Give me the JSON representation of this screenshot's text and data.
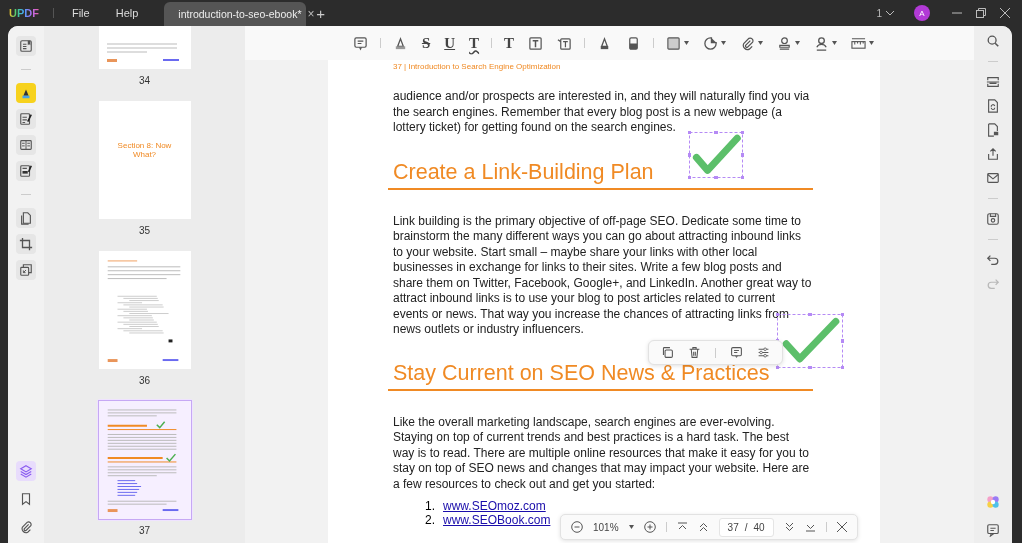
{
  "title_bar": {
    "logo": "UPDF",
    "menus": [
      "File",
      "Help"
    ],
    "tab": {
      "title": "introduction-to-seo-ebook*",
      "close": "×"
    },
    "new_tab": "+",
    "page_count": "1",
    "avatar": "A"
  },
  "left_tool_groups": [
    [
      {
        "kind": "reader",
        "selected": false
      }
    ],
    [
      {
        "kind": "comment",
        "selected": true
      },
      {
        "kind": "edit",
        "selected": false
      },
      {
        "kind": "organize",
        "selected": false
      },
      {
        "kind": "form",
        "selected": false
      }
    ],
    [
      {
        "kind": "pages",
        "selected": false
      },
      {
        "kind": "crop",
        "selected": false
      },
      {
        "kind": "compress",
        "selected": false
      }
    ]
  ],
  "left_bottom": [
    {
      "kind": "layers",
      "selected": true
    },
    {
      "kind": "bookmark",
      "selected": false
    },
    {
      "kind": "attachment",
      "selected": false
    }
  ],
  "thumbnails": [
    {
      "kind": "text",
      "page": "34",
      "selected": false
    },
    {
      "kind": "section",
      "page": "35",
      "selected": false,
      "title": "Section 8: Now What?"
    },
    {
      "kind": "diagram",
      "page": "36",
      "selected": false
    },
    {
      "kind": "article",
      "page": "37",
      "selected": true
    }
  ],
  "toolbar_groups": [
    [
      {
        "kind": "note",
        "dropdown": false
      }
    ],
    [
      {
        "kind": "highlight",
        "dropdown": false
      },
      {
        "kind": "strikethrough",
        "glyph": "S",
        "dropdown": false
      },
      {
        "kind": "underline",
        "glyph": "U",
        "dropdown": false
      },
      {
        "kind": "squiggly",
        "glyph": "T",
        "dropdown": false
      }
    ],
    [
      {
        "kind": "text",
        "glyph": "T",
        "dropdown": false
      },
      {
        "kind": "textbox",
        "dropdown": false
      },
      {
        "kind": "callout",
        "dropdown": false
      }
    ],
    [
      {
        "kind": "pencil",
        "dropdown": false
      },
      {
        "kind": "eraser",
        "dropdown": false
      }
    ],
    [
      {
        "kind": "shape",
        "dropdown": true
      },
      {
        "kind": "sticker",
        "dropdown": true
      },
      {
        "kind": "attachment",
        "dropdown": true
      },
      {
        "kind": "stamp",
        "dropdown": true
      },
      {
        "kind": "signature",
        "dropdown": true
      },
      {
        "kind": "measure",
        "dropdown": true
      }
    ]
  ],
  "page": {
    "header": "37 | Introduction to Search Engine Optimization",
    "blocks": [
      {
        "kind": "paragraph",
        "text": "audience and/or prospects are interested in, and they will naturally find you via the search engines. Remember that every blog post is a new webpage (a lottery ticket) for getting found on the search engines."
      },
      {
        "kind": "heading",
        "text": "Create a Link-Building Plan",
        "annotation": {
          "kind": "checkmark",
          "selected": true
        }
      },
      {
        "kind": "paragraph",
        "text": "Link building is the primary objective of off-page SEO. Dedicate some time to brainstorm the many different ways you can go about attracting inbound links to your website. Start small – maybe share your links with other local businesses in exchange for links to their sites. Write a few blog posts and share them on Twitter, Facebook, Google+, and LinkedIn. Another great way to attract inbound links is to use your blog to post articles related to current events or news. That way you increase the chances of attracting links from news outlets or industry influencers."
      },
      {
        "kind": "heading",
        "text": "Stay Current on SEO News & Practices",
        "annotation": {
          "kind": "checkmark",
          "selected": true
        }
      },
      {
        "kind": "paragraph",
        "text": "Like the overall marketing landscape, search engines are ever-evolving. Staying on top of current trends and best practices is a hard task. The best way is to read. There are multiple online resources that make it easy for you to stay on top of SEO news and changes that may impact your website. Here are a few resources to check out and get you started:"
      },
      {
        "kind": "list",
        "items": [
          {
            "number": "1.",
            "text": "www.SEOmoz.com"
          },
          {
            "number": "2.",
            "text": "www.SEOBook.com"
          }
        ]
      }
    ]
  },
  "annotation_toolbar": [
    {
      "kind": "copy"
    },
    {
      "kind": "delete"
    },
    {
      "kind": "note"
    },
    {
      "kind": "properties"
    }
  ],
  "zoom_bar": {
    "zoom": "101%",
    "page": "37",
    "separator": "/",
    "total": "40"
  },
  "right_tool_groups": [
    [
      {
        "kind": "search",
        "disabled": false
      }
    ],
    [
      {
        "kind": "ocr",
        "disabled": false
      },
      {
        "kind": "convert",
        "disabled": false
      },
      {
        "kind": "protect",
        "disabled": false
      },
      {
        "kind": "share",
        "disabled": false
      },
      {
        "kind": "email",
        "disabled": false
      }
    ],
    [
      {
        "kind": "save",
        "disabled": false
      }
    ],
    [
      {
        "kind": "undo",
        "disabled": false
      },
      {
        "kind": "redo",
        "disabled": true
      }
    ]
  ],
  "right_bottom": [
    {
      "kind": "ai",
      "disabled": false
    },
    {
      "kind": "chat",
      "disabled": false
    }
  ]
}
